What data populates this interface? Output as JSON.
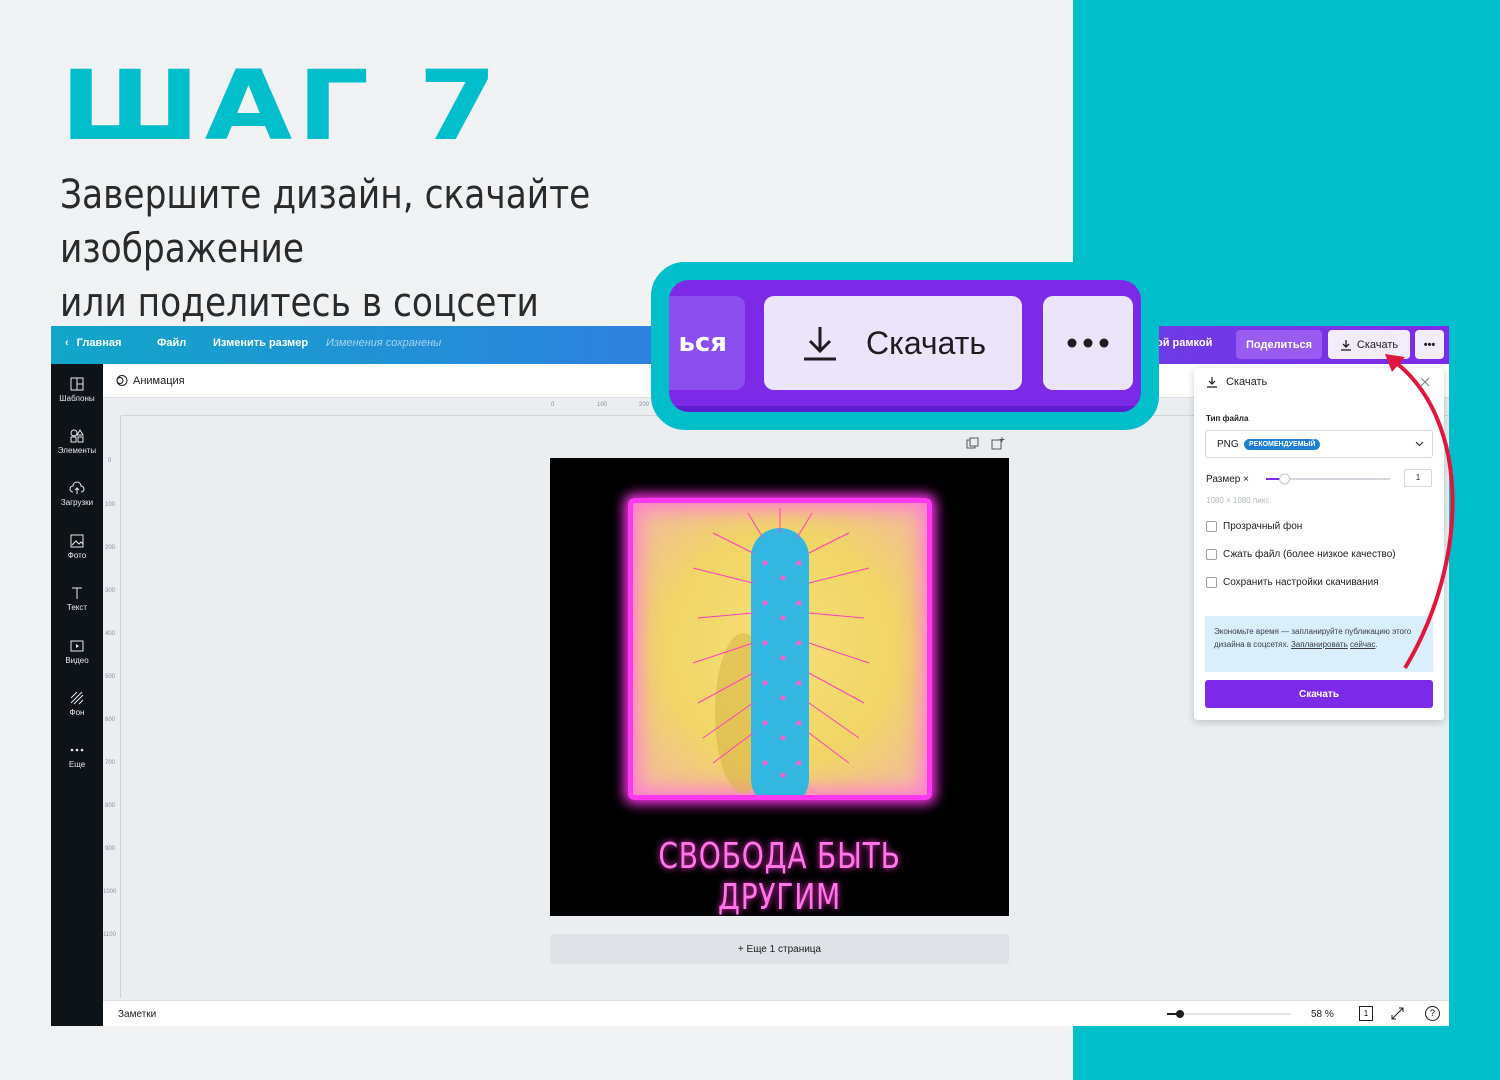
{
  "colors": {
    "teal": "#00bfca",
    "purple": "#7d2ae8",
    "neon_pink": "#ff39f0",
    "arrow_red": "#e0163f"
  },
  "heading": {
    "title": "ШАГ 7",
    "subtitle_line1": "Завершите дизайн, скачайте изображение",
    "subtitle_line2": "или поделитесь в соцсети"
  },
  "topbar": {
    "home": "Главная",
    "file": "Файл",
    "resize": "Изменить размер",
    "saved": "Изменения сохранены",
    "frame_label": "ой рамкой",
    "share": "Поделиться",
    "download": "Скачать",
    "more": "•••"
  },
  "sidebar": {
    "items": [
      {
        "label": "Шаблоны",
        "icon": "templates-icon"
      },
      {
        "label": "Элементы",
        "icon": "elements-icon"
      },
      {
        "label": "Загрузки",
        "icon": "uploads-icon"
      },
      {
        "label": "Фото",
        "icon": "photo-icon"
      },
      {
        "label": "Текст",
        "icon": "text-icon"
      },
      {
        "label": "Видео",
        "icon": "video-icon"
      },
      {
        "label": "Фон",
        "icon": "background-icon"
      },
      {
        "label": "Еще",
        "icon": "more-icon"
      }
    ]
  },
  "toolbar": {
    "animation": "Анимация"
  },
  "ruler": {
    "top": [
      "0",
      "100",
      "200"
    ],
    "left": [
      "0",
      "100",
      "200",
      "300",
      "400",
      "500",
      "600",
      "700",
      "800",
      "900",
      "1000",
      "1100"
    ]
  },
  "design": {
    "caption": "СВОБОДА БЫТЬ ДРУГИМ"
  },
  "more_pages": "+ Еще 1 страница",
  "bottombar": {
    "notes": "Заметки",
    "zoom": "58 %",
    "pages": "1",
    "help": "?"
  },
  "download_panel": {
    "title": "Скачать",
    "file_type_label": "Тип файла",
    "file_type_value": "PNG",
    "recommended": "РЕКОМЕНДУЕМЫЙ",
    "size_label": "Размер ×",
    "size_value": "1",
    "size_scale": 0.15,
    "dimensions": "1080 × 1080 пикс.",
    "options": [
      "Прозрачный фон",
      "Сжать файл (более низкое качество)",
      "Сохранить настройки скачивания"
    ],
    "promo_text": "Экономьте время — запланируйте публикацию этого дизайна в соцсетях.",
    "promo_link_1": "Запланировать",
    "promo_link_2": "сейчас",
    "button": "Скачать"
  },
  "callout": {
    "partial_text": "ься",
    "download": "Скачать",
    "more": "•••"
  }
}
